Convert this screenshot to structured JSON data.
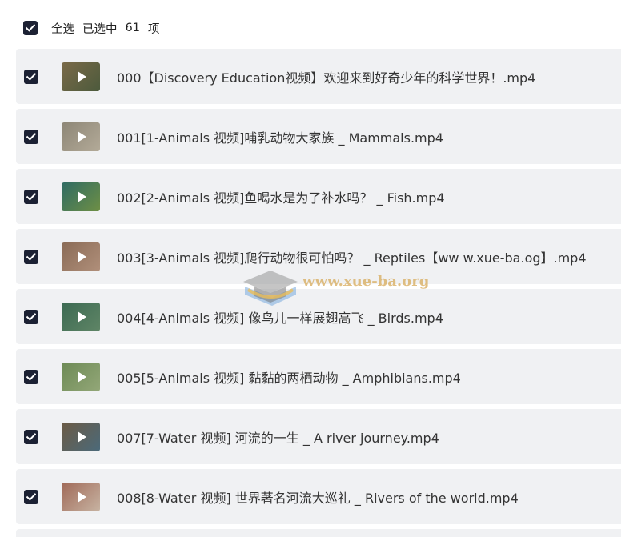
{
  "header": {
    "select_all": "全选",
    "selected_prefix": "已选中",
    "selected_count": "61",
    "selected_unit": "项"
  },
  "files": [
    {
      "name": "000【Discovery Education视频】欢迎来到好奇少年的科学世界！.mp4",
      "thumb": [
        "#7a6a48",
        "#4c5a3c"
      ]
    },
    {
      "name": "001[1-Animals 视频]哺乳动物大家族 _ Mammals.mp4",
      "thumb": [
        "#8d8676",
        "#b3aa98"
      ]
    },
    {
      "name": "002[2-Animals 视频]鱼喝水是为了补水吗？ _ Fish.mp4",
      "thumb": [
        "#2f6b63",
        "#6e8f45"
      ]
    },
    {
      "name": "003[3-Animals 视频]爬行动物很可怕吗？ _ Reptiles【ww w.xue-ba.og】.mp4",
      "thumb": [
        "#8a6b56",
        "#b08f7a"
      ]
    },
    {
      "name": "004[4-Animals 视频] 像鸟儿一样展翅高飞 _ Birds.mp4",
      "thumb": [
        "#3c6a52",
        "#5f8566"
      ]
    },
    {
      "name": "005[5-Animals 视频] 黏黏的两栖动物 _ Amphibians.mp4",
      "thumb": [
        "#6d8a55",
        "#93a778"
      ]
    },
    {
      "name": "007[7-Water 视频] 河流的一生 _ A river journey.mp4",
      "thumb": [
        "#6b5a44",
        "#4b6a7a"
      ]
    },
    {
      "name": "008[8-Water 视频] 世界著名河流大巡礼 _ Rivers of the world.mp4",
      "thumb": [
        "#a06a58",
        "#c7b3a2"
      ]
    }
  ],
  "watermark": {
    "text": "www.xue-ba.org"
  },
  "colors": {
    "checkbox": "#1c2133",
    "row_background": "#f0f1f3"
  },
  "icons": {
    "checkbox": "check-icon",
    "thumbnail_overlay": "play-icon"
  }
}
